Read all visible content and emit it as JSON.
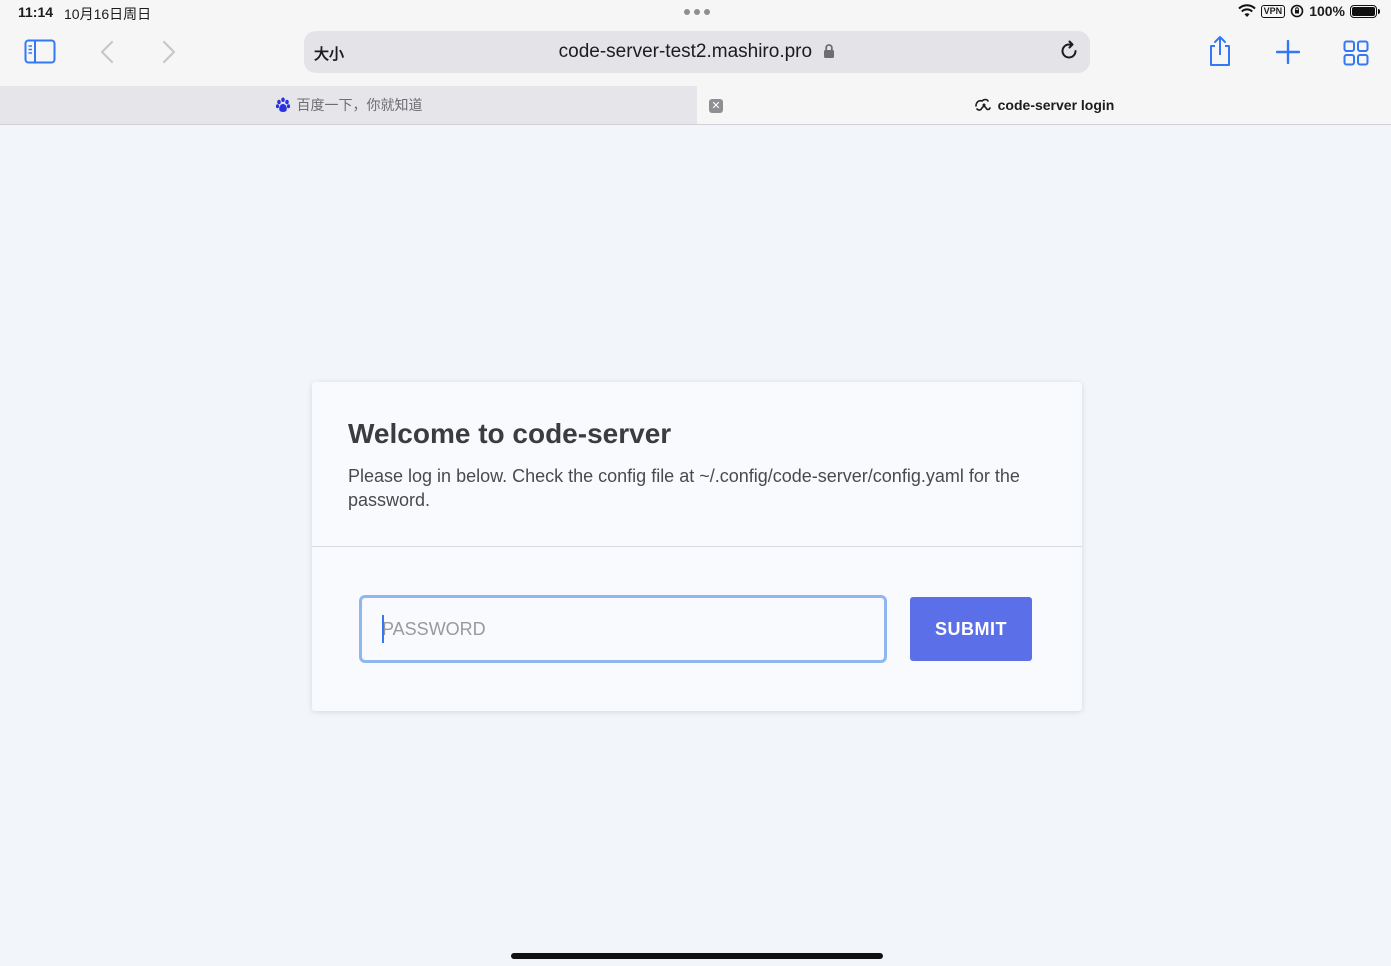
{
  "status_bar": {
    "time": "11:14",
    "date": "10月16日周日",
    "vpn": "VPN",
    "battery": "100%"
  },
  "toolbar": {
    "size_label": "大小",
    "url": "code-server-test2.mashiro.pro"
  },
  "tabs": [
    {
      "title": "百度一下，你就知道",
      "active": false
    },
    {
      "title": "code-server login",
      "active": true
    }
  ],
  "login": {
    "title": "Welcome to code-server",
    "description": "Please log in below. Check the config file at ~/.config/code-server/config.yaml for the password.",
    "password_placeholder": "PASSWORD",
    "submit_label": "SUBMIT"
  },
  "colors": {
    "accent": "#3478f6",
    "submit": "#5b70e8",
    "input_focus": "#8fb6ef"
  }
}
